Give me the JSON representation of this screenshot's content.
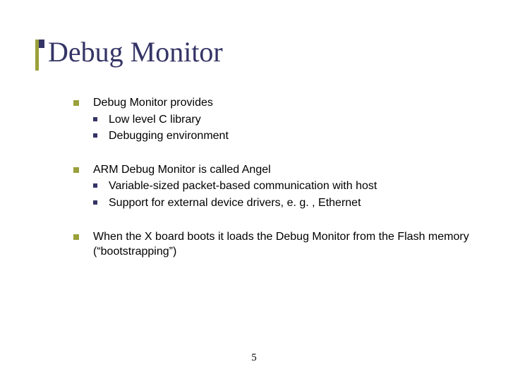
{
  "title": "Debug Monitor",
  "bullets": [
    {
      "text": "Debug Monitor provides",
      "children": [
        "Low level C library",
        "Debugging environment"
      ]
    },
    {
      "text": "ARM Debug Monitor is called Angel",
      "children": [
        "Variable-sized packet-based communication with host",
        "Support for external device drivers, e. g. , Ethernet"
      ]
    },
    {
      "text": "When the X board boots it loads the Debug Monitor from the Flash memory (“bootstrapping”)",
      "children": []
    }
  ],
  "pageNumber": "5"
}
